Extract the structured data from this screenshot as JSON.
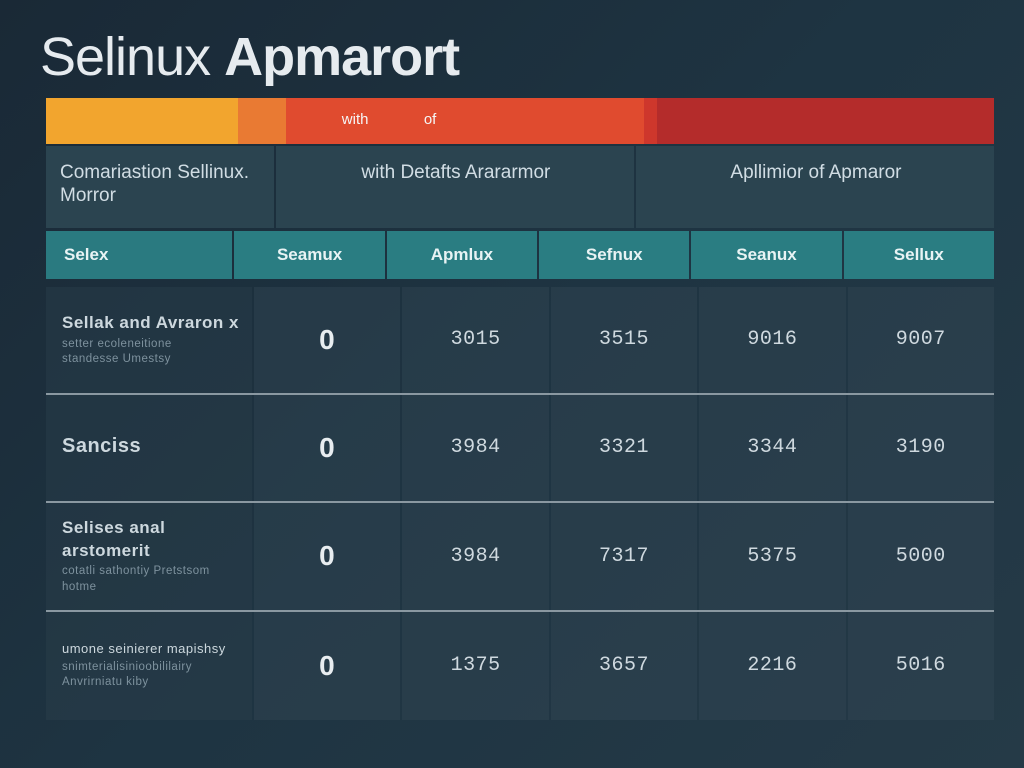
{
  "title": {
    "part1": "Selinux",
    "part2": "Apmarort"
  },
  "stripe_labels": {
    "with": "with",
    "of": "of"
  },
  "group_headers": [
    "Comariastion Sellinux. Morror",
    "with Detafts Arararmor",
    "Apllimior of Apmaror"
  ],
  "columns": [
    "Selex",
    "Seamux",
    "Apmlux",
    "Sefnux",
    "Seanux",
    "Sellux"
  ],
  "rows": [
    {
      "label_main": "Sellak and Avraron x",
      "label_subs": [
        "setter ecoleneitione",
        "standesse Umestsy"
      ],
      "cells": [
        "0",
        "3015",
        "3515",
        "9016",
        "9007"
      ]
    },
    {
      "label_main": "Sanciss",
      "label_subs": [],
      "cells": [
        "0",
        "3984",
        "3321",
        "3344",
        "3190"
      ]
    },
    {
      "label_main": "Selises anal arstomerit",
      "label_subs": [
        "cotatli sathontiy Pretstsom",
        "hotme"
      ],
      "cells": [
        "0",
        "3984",
        "7317",
        "5375",
        "5000"
      ]
    },
    {
      "label_main": "umone seinierer mapishsy",
      "label_subs": [
        "snimterialisinioobililairy",
        "Anvrirniatu kiby"
      ],
      "cells": [
        "0",
        "1375",
        "3657",
        "2216",
        "5016"
      ]
    }
  ],
  "chart_data": {
    "type": "table",
    "title": "Selinux Apmarort",
    "columns": [
      "Selex",
      "Seamux",
      "Apmlux",
      "Sefnux",
      "Seanux",
      "Sellux"
    ],
    "series": [
      {
        "name": "Sellak and Avraron x",
        "values": [
          0,
          3015,
          3515,
          9016,
          9007
        ]
      },
      {
        "name": "Sanciss",
        "values": [
          0,
          3984,
          3321,
          3344,
          3190
        ]
      },
      {
        "name": "Selises anal arstomerit",
        "values": [
          0,
          3984,
          7317,
          5375,
          5000
        ]
      },
      {
        "name": "umone seinierer mapishsy",
        "values": [
          0,
          1375,
          3657,
          2216,
          5016
        ]
      }
    ],
    "column_groups": [
      "Comariastion Sellinux. Morror",
      "with Detafts Arararmor",
      "Apllimior of Apmaror"
    ]
  }
}
